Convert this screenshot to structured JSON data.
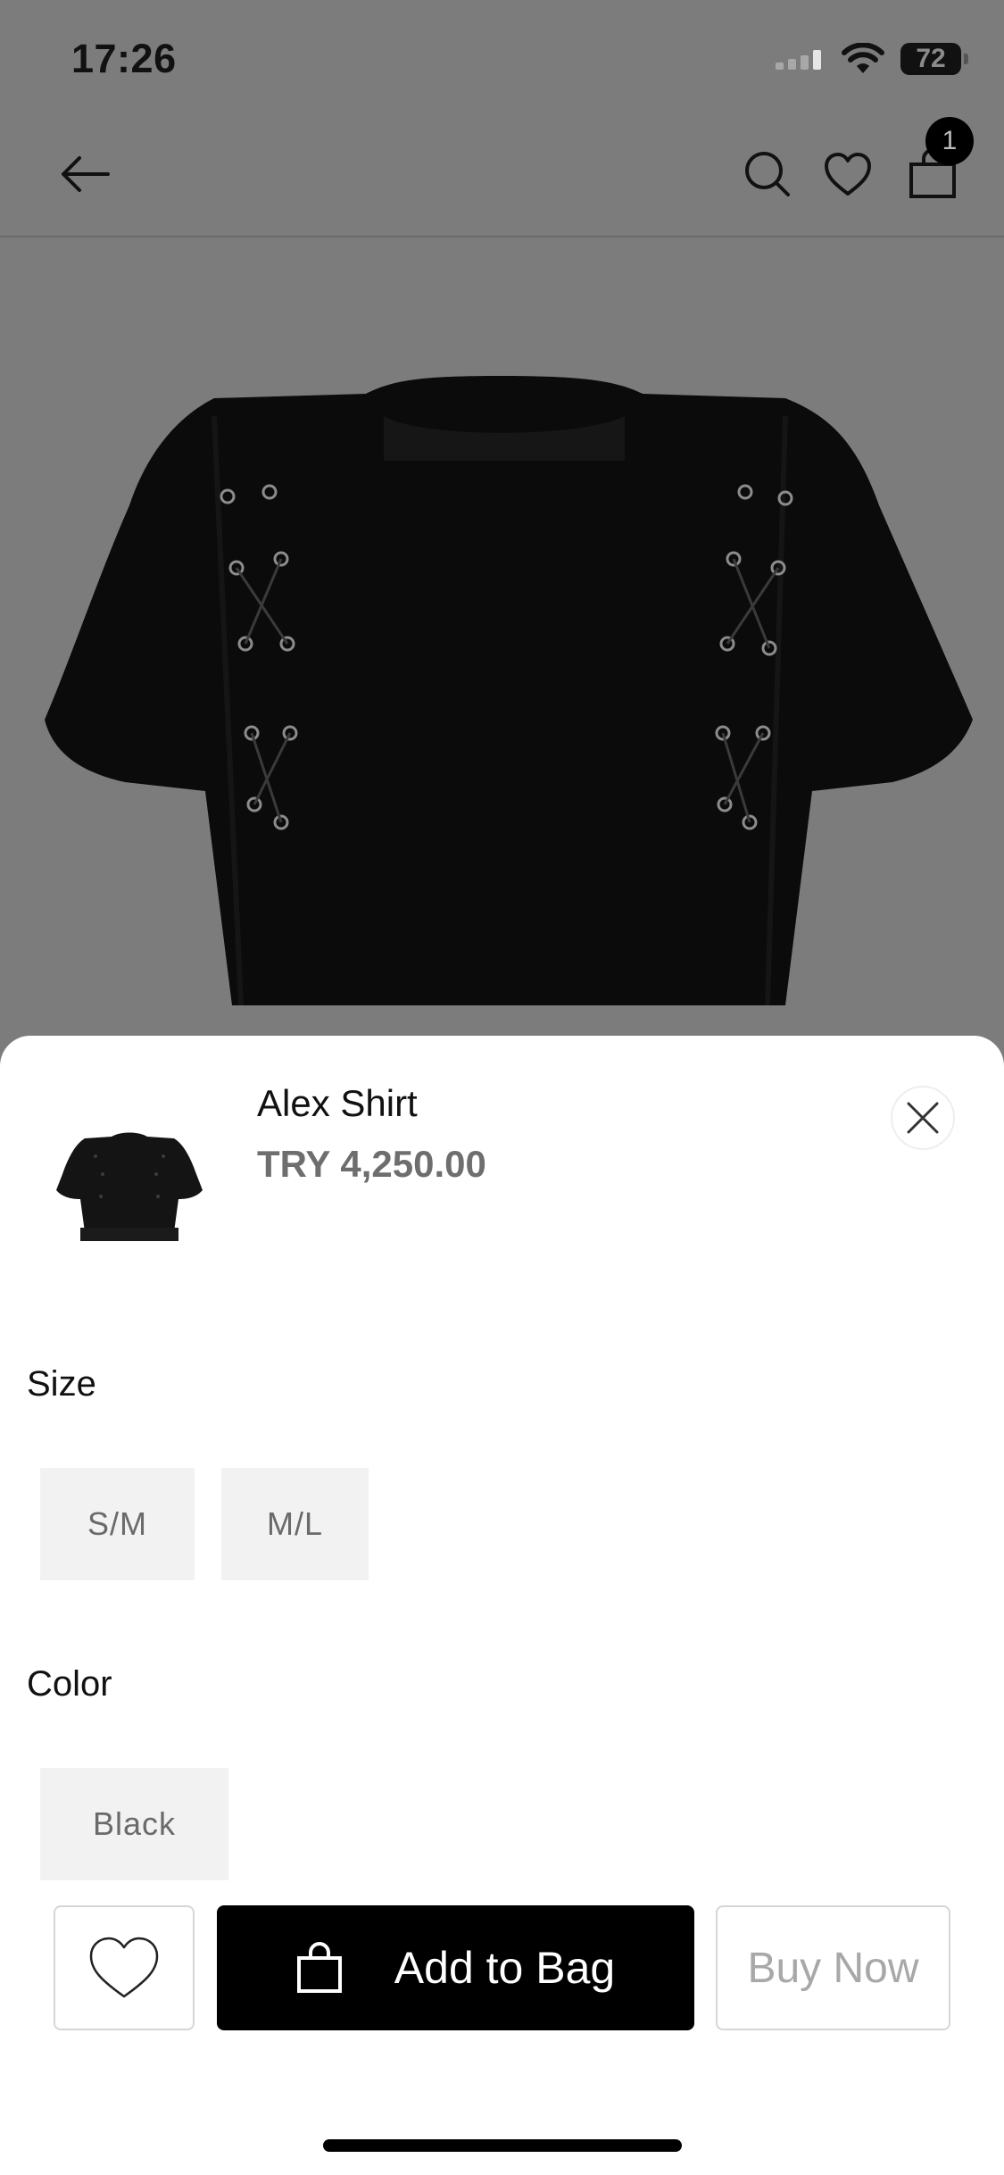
{
  "status_bar": {
    "time": "17:26",
    "battery": "72"
  },
  "nav": {
    "cart_count": "1"
  },
  "product": {
    "name": "Alex Shirt",
    "price": "TRY 4,250.00"
  },
  "options": {
    "size_label": "Size",
    "sizes": [
      "S/M",
      "M/L"
    ],
    "color_label": "Color",
    "colors": [
      "Black"
    ]
  },
  "actions": {
    "add_to_bag": "Add to Bag",
    "buy_now": "Buy Now"
  },
  "colors": {
    "overlay": "#7c7c7c",
    "primary_button": "#000000",
    "option_bg": "#f2f2f2"
  }
}
